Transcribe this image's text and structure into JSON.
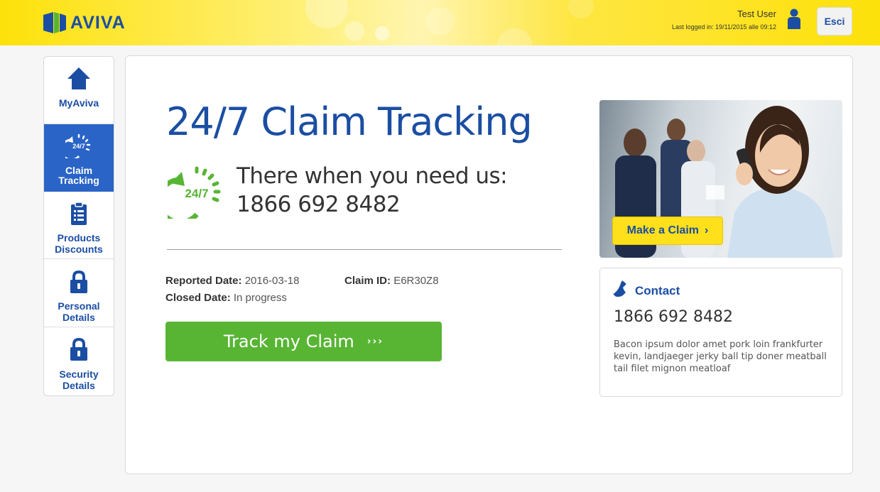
{
  "header": {
    "brand": "AVIVA",
    "user_name": "Test User",
    "last_login": "Last logged in: 19/11/2015 alle 09:12",
    "logout_label": "Esci"
  },
  "sidebar": {
    "items": [
      {
        "label_lines": [
          "MyAviva"
        ],
        "icon": "home-icon",
        "active": false
      },
      {
        "label_lines": [
          "Claim",
          "Tracking"
        ],
        "icon": "claim-tracking-24-7-icon",
        "active": true,
        "icon_text": "24/7"
      },
      {
        "label_lines": [
          "Products",
          "Discounts"
        ],
        "icon": "clipboard-icon",
        "active": false
      },
      {
        "label_lines": [
          "Personal",
          "Details"
        ],
        "icon": "lock-icon",
        "active": false
      },
      {
        "label_lines": [
          "Security",
          "Details"
        ],
        "icon": "lock-icon",
        "active": false
      }
    ]
  },
  "main": {
    "title": "24/7 Claim Tracking",
    "clock_icon_text": "24/7",
    "tagline": "There when you need us:",
    "phone": "1866 692 8482",
    "reported_label": "Reported Date:",
    "reported_value": "2016-03-18",
    "claim_id_label": "Claim ID:",
    "claim_id_value": "E6R30Z8",
    "closed_label": "Closed Date:",
    "closed_value": "In progress",
    "track_button_label": "Track my Claim",
    "track_button_chevrons": "›››"
  },
  "promo": {
    "make_claim_label": "Make a Claim",
    "make_claim_chevron": "›"
  },
  "contact": {
    "title": "Contact",
    "phone": "1866 692 8482",
    "text": "Bacon ipsum dolor amet pork loin frankfurter kevin, landjaeger jerky ball tip doner meatball tail filet mignon meatloaf"
  },
  "colors": {
    "brand_blue": "#1b4ea3",
    "active_blue": "#2a64c6",
    "brand_yellow": "#fde10a",
    "action_green": "#58b534"
  }
}
